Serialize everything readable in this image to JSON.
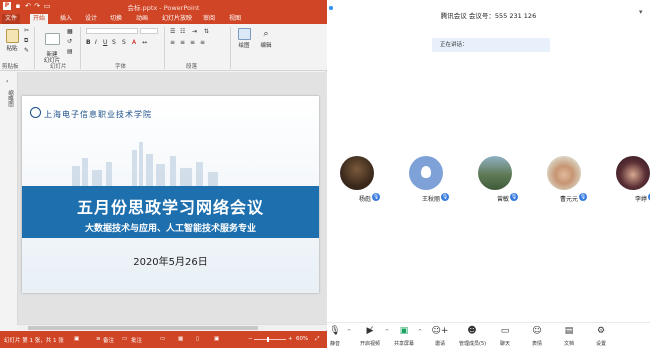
{
  "ppt": {
    "title": "会标.pptx  -  PowerPoint",
    "tabs": [
      "文件",
      "开始",
      "插入",
      "设计",
      "切换",
      "动画",
      "幻灯片放映",
      "审阅",
      "视图"
    ],
    "active_tab": "开始",
    "ribbon": {
      "paste_label": "粘贴",
      "new_slide_label": "新建\n幻灯片",
      "drawing_label": "绘图",
      "editing_label": "编辑",
      "groups": [
        "剪贴板",
        "幻灯片",
        "字体",
        "段落"
      ]
    },
    "thumbnail_strip_label": "缩略图",
    "slide": {
      "school_name": "上海电子信息职业技术学院",
      "main_title": "五月份思政学习网络会议",
      "subtitle": "大数据技术与应用、人工智能技术服务专业",
      "date": "2020年5月26日"
    },
    "statusbar": {
      "slide_info": "幻灯片 第 1 张，共 1 张",
      "notes": "备注",
      "comments": "批注",
      "zoom": "60%"
    }
  },
  "meeting": {
    "title": "腾讯会议  会议号：555 231 126",
    "speaking": "正在讲话：",
    "participants": [
      {
        "name": "杨彪"
      },
      {
        "name": "王秋丽"
      },
      {
        "name": "曾敏"
      },
      {
        "name": "曹元元"
      },
      {
        "name": "李婷"
      }
    ],
    "toolbar": [
      {
        "label": "静音",
        "icon": "mic-icon"
      },
      {
        "label": "开启视频",
        "icon": "video-off-icon"
      },
      {
        "label": "共享屏幕",
        "icon": "share-screen-icon"
      },
      {
        "label": "邀请",
        "icon": "invite-icon"
      },
      {
        "label": "管理成员(5)",
        "icon": "members-icon"
      },
      {
        "label": "聊天",
        "icon": "chat-icon"
      },
      {
        "label": "表情",
        "icon": "emoji-icon"
      },
      {
        "label": "文档",
        "icon": "document-icon"
      },
      {
        "label": "设置",
        "icon": "settings-icon"
      }
    ]
  }
}
